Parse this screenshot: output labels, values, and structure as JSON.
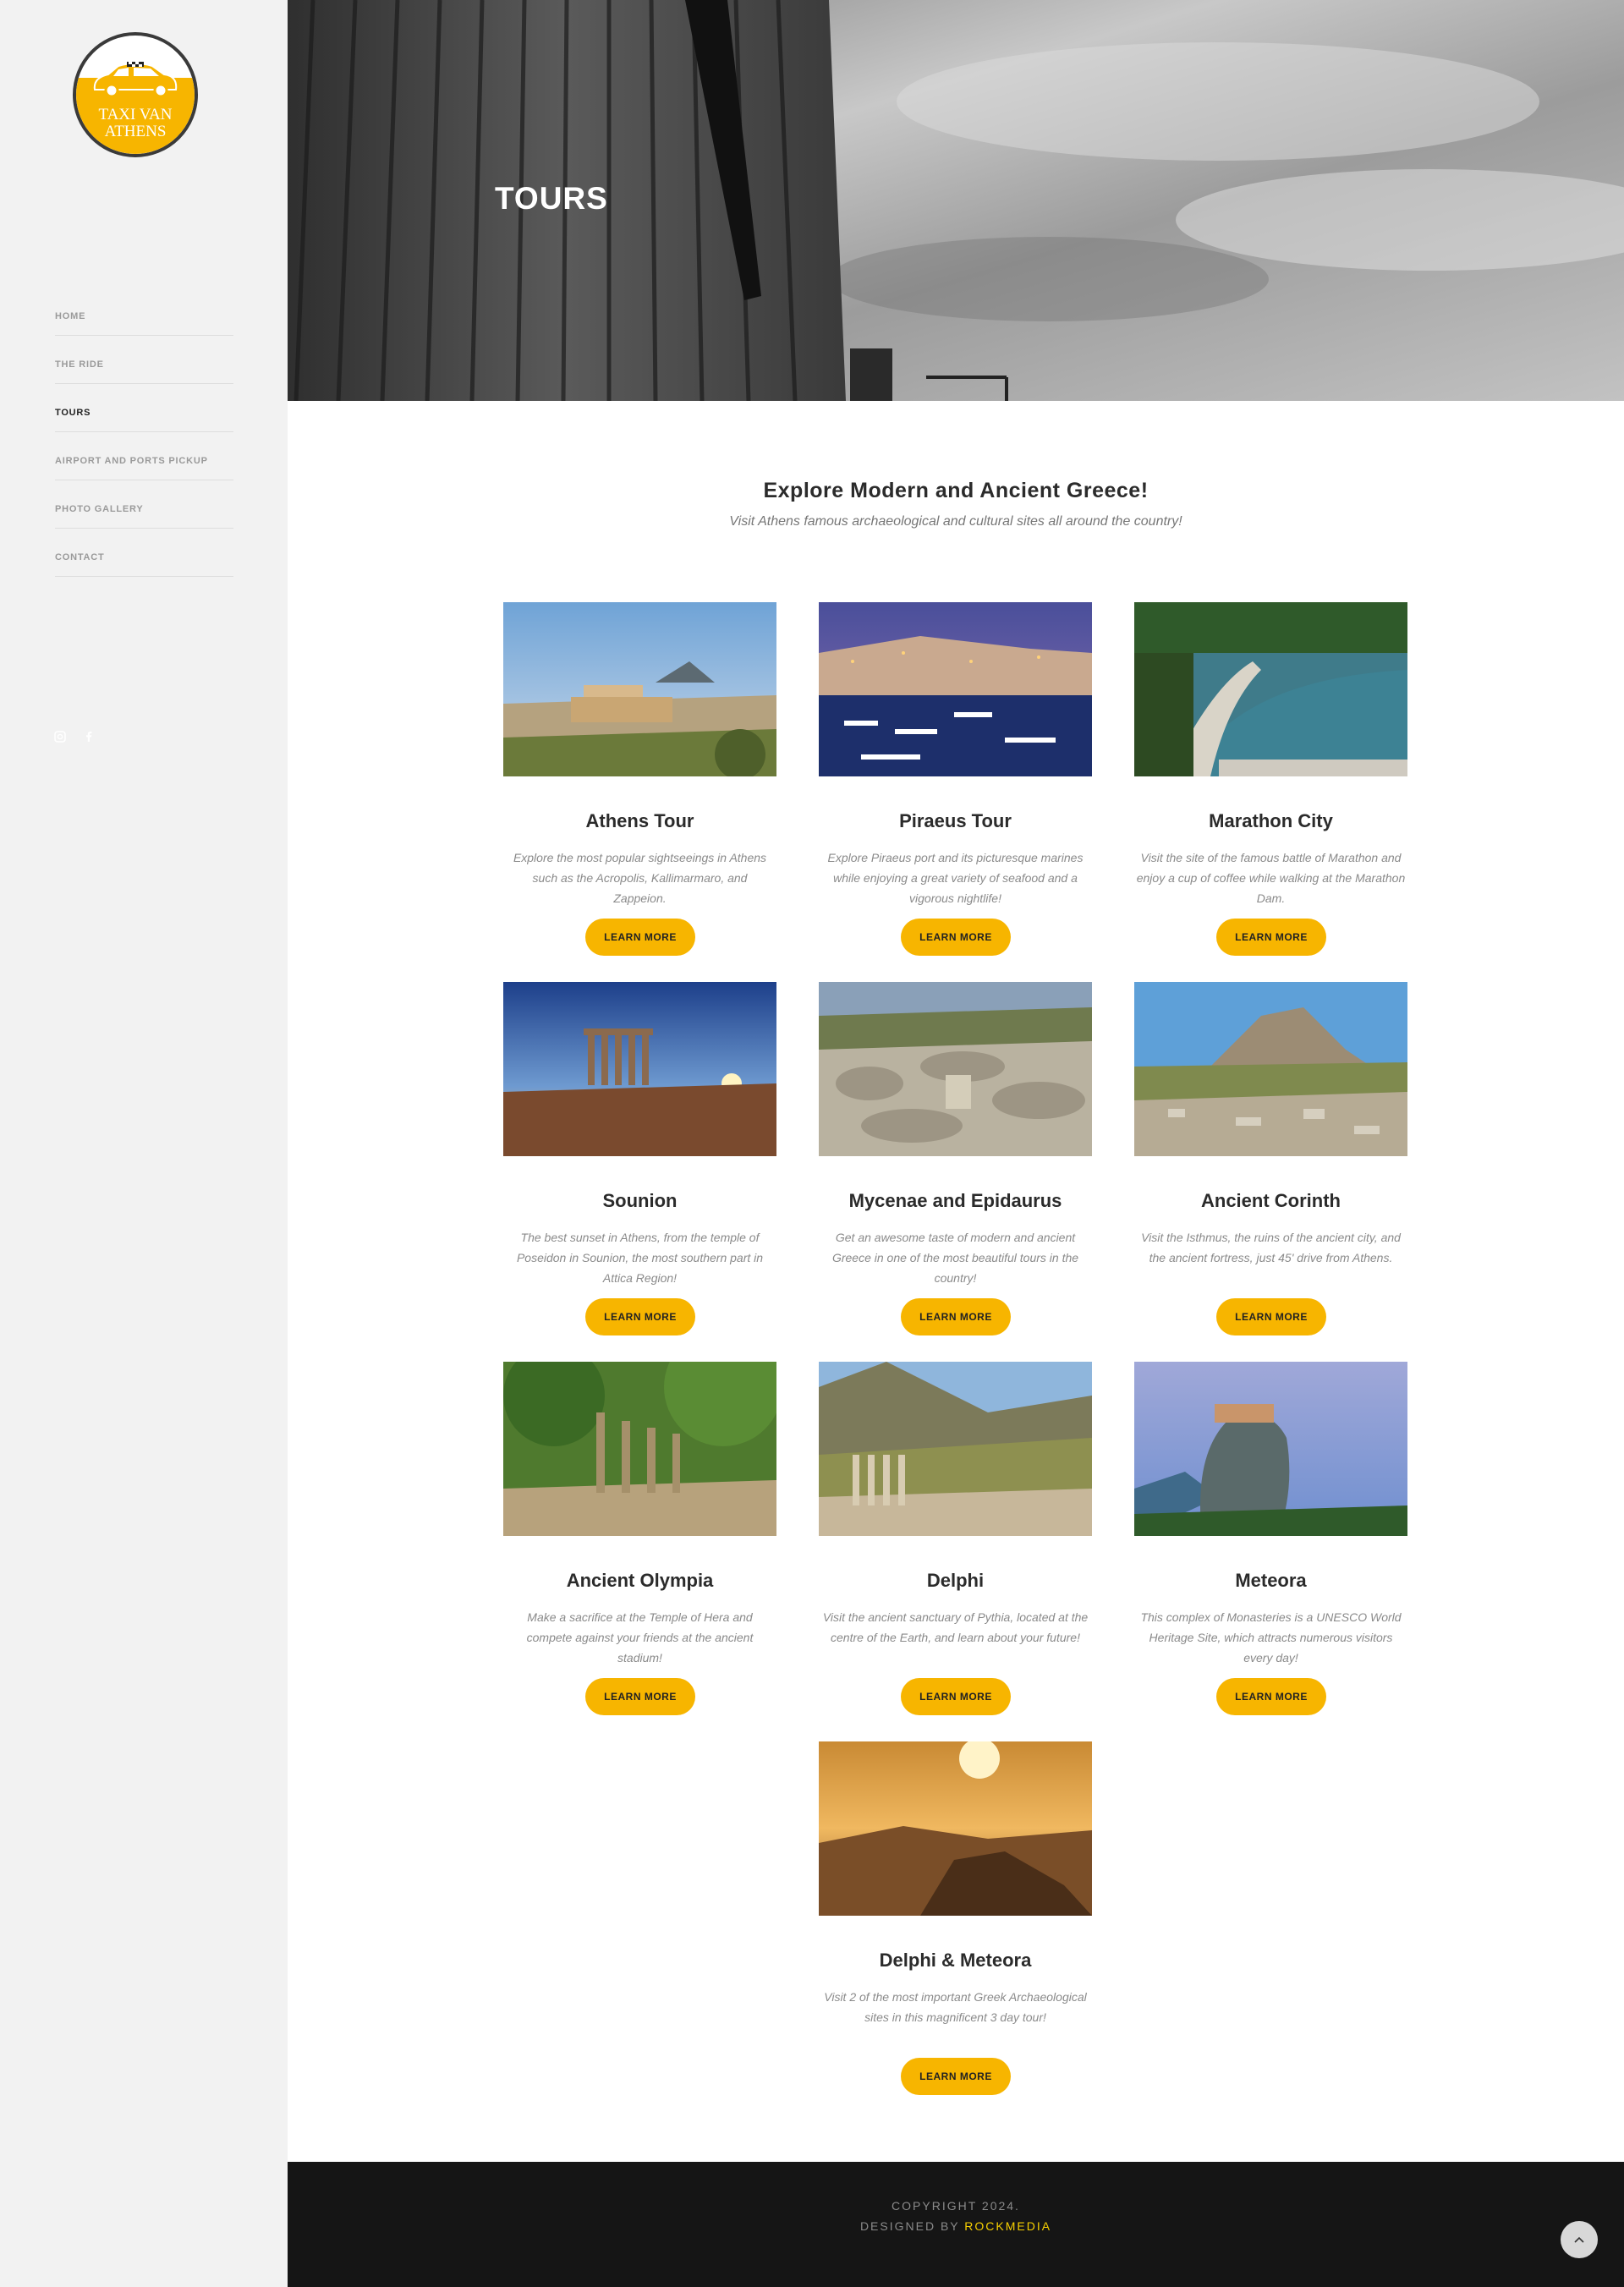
{
  "brand": {
    "logo_line1": "TAXI VAN",
    "logo_line2": "ATHENS",
    "accent_color": "#f7b500"
  },
  "sidebar": {
    "nav": [
      {
        "label": "HOME",
        "active": false
      },
      {
        "label": "THE RIDE",
        "active": false
      },
      {
        "label": "TOURS",
        "active": true
      },
      {
        "label": "AIRPORT AND PORTS PICKUP",
        "active": false
      },
      {
        "label": "PHOTO GALLERY",
        "active": false
      },
      {
        "label": "CONTACT",
        "active": false
      }
    ],
    "social_icons": [
      "instagram-icon",
      "facebook-icon"
    ]
  },
  "hero": {
    "title": "TOURS"
  },
  "intro": {
    "title": "Explore Modern and Ancient Greece!",
    "subtitle": "Visit Athens famous archaeological and cultural sites all around the country!"
  },
  "tours": [
    {
      "name": "Athens Tour",
      "description": "Explore the most popular sightseeings in Athens such as the Acropolis, Kallimarmaro, and Zappeion.",
      "button": "LEARN MORE"
    },
    {
      "name": "Piraeus Tour",
      "description": "Explore Piraeus port and its picturesque marines while enjoying a great variety of seafood and a vigorous nightlife!",
      "button": "LEARN MORE"
    },
    {
      "name": "Marathon City",
      "description": "Visit the site of the famous battle of Marathon and enjoy a cup of coffee while walking at the Marathon Dam.",
      "button": "LEARN MORE"
    },
    {
      "name": "Sounion",
      "description": "The best sunset in Athens, from the temple of Poseidon in Sounion, the most southern part in Attica Region!",
      "button": "LEARN MORE"
    },
    {
      "name": "Mycenae and Epidaurus",
      "description": "Get an awesome taste of modern and ancient Greece in one of the most beautiful tours in the country!",
      "button": "LEARN MORE"
    },
    {
      "name": "Ancient Corinth",
      "description": "Visit the Isthmus, the ruins of the ancient city, and the ancient fortress, just 45' drive from Athens.",
      "button": "LEARN MORE"
    },
    {
      "name": "Ancient Olympia",
      "description": "Make a sacrifice at the Temple of Hera and compete against your friends at the ancient stadium!",
      "button": "LEARN MORE"
    },
    {
      "name": "Delphi",
      "description": "Visit the ancient sanctuary of Pythia, located at the centre of the Earth, and learn about your future!",
      "button": "LEARN MORE"
    },
    {
      "name": "Meteora",
      "description": "This complex of Monasteries is a UNESCO World Heritage Site, which attracts numerous visitors every day!",
      "button": "LEARN MORE"
    },
    {
      "name": "Delphi & Meteora",
      "description": "Visit 2 of the most important Greek Archaeological sites in this magnificent 3 day tour!",
      "button": "LEARN MORE"
    }
  ],
  "footer": {
    "copyright": "COPYRIGHT 2024.",
    "designed_by_prefix": "DESIGNED BY ",
    "designed_by_brand": "ROCKMEDIA"
  }
}
